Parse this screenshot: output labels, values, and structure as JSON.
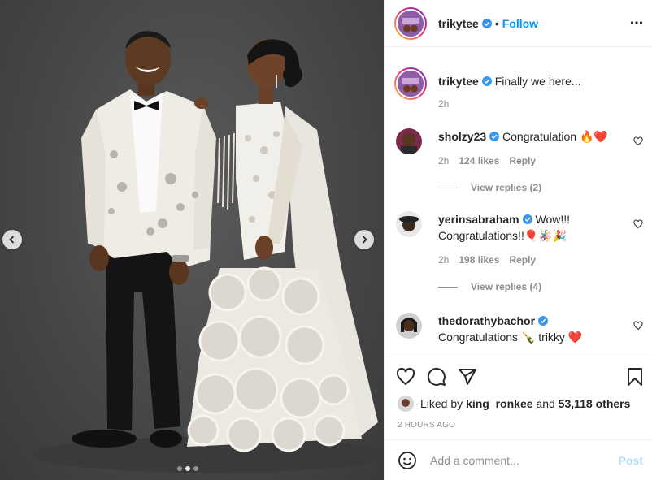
{
  "post": {
    "author": "trikytee",
    "follow_label": "Follow",
    "follow_separator": "•",
    "caption": "Finally we here...",
    "caption_age": "2h",
    "carousel": {
      "slide_count": 3,
      "active_slide": 2
    }
  },
  "comments": [
    {
      "username": "sholzy23",
      "text": "Congratulation 🔥❤️",
      "age": "2h",
      "likes": "124 likes",
      "reply_label": "Reply",
      "view_replies": "View replies (2)"
    },
    {
      "username": "yerinsabraham",
      "text": "Wow!!! Congratulations!!🎈🪅🎉",
      "age": "2h",
      "likes": "198 likes",
      "reply_label": "Reply",
      "view_replies": "View replies (4)"
    },
    {
      "username": "thedorathybachor",
      "text": "Congratulations 🍾 trikky ❤️"
    }
  ],
  "footer": {
    "liked_prefix": "Liked by",
    "liked_user": "king_ronkee",
    "liked_and": "and",
    "liked_others": "53,118 others",
    "timestamp": "2 HOURS AGO",
    "comment_placeholder": "Add a comment...",
    "post_label": "Post"
  },
  "icons": {
    "header": [
      "verified-badge-icon",
      "more-options-icon"
    ],
    "actions": [
      "heart-icon",
      "comment-icon",
      "share-icon",
      "bookmark-icon"
    ],
    "carousel": [
      "chevron-left-icon",
      "chevron-right-icon"
    ],
    "composer": [
      "emoji-icon"
    ]
  },
  "colors": {
    "link_blue": "#0095f6",
    "post_disabled": "#b2dffc",
    "verified_blue": "#3897f0",
    "muted_text": "#8e8e8e",
    "like_red": "#ed4956"
  }
}
